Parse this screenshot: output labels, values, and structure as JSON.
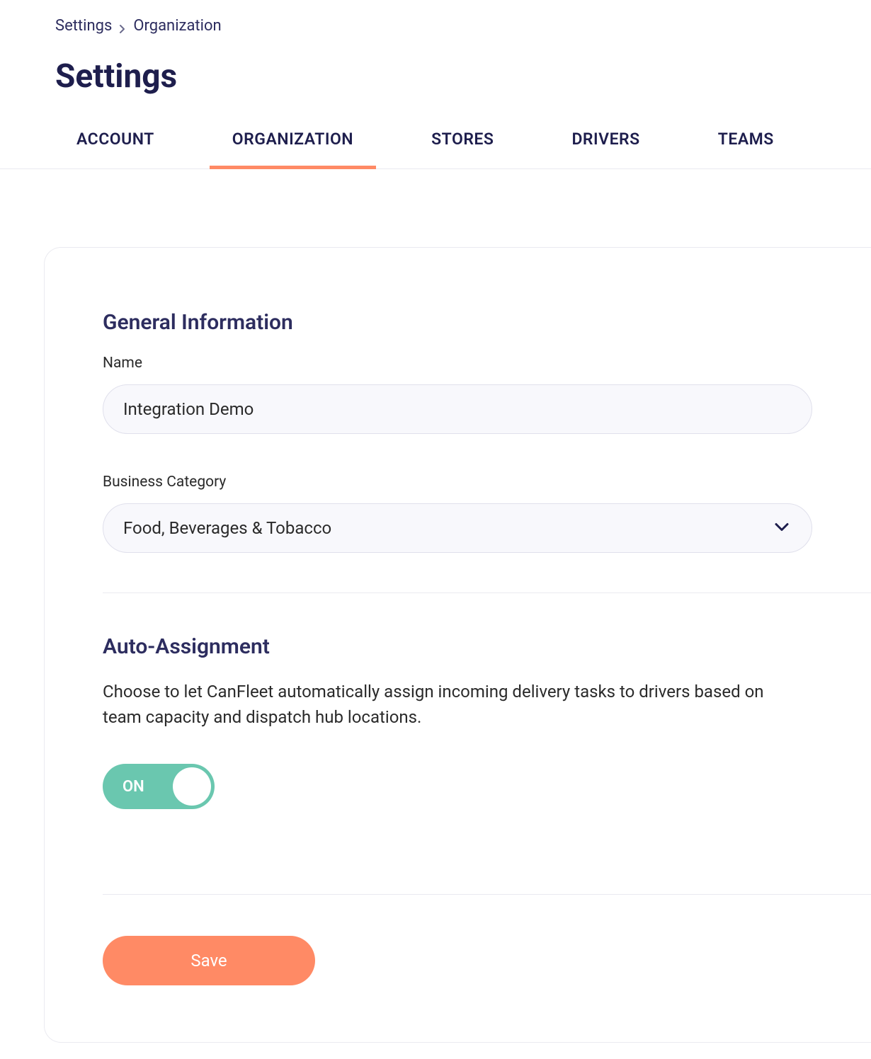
{
  "breadcrumb": {
    "root": "Settings",
    "current": "Organization"
  },
  "page_title": "Settings",
  "tabs": [
    {
      "label": "ACCOUNT",
      "active": false
    },
    {
      "label": "ORGANIZATION",
      "active": true
    },
    {
      "label": "STORES",
      "active": false
    },
    {
      "label": "DRIVERS",
      "active": false
    },
    {
      "label": "TEAMS",
      "active": false
    }
  ],
  "sections": {
    "general": {
      "title": "General Information",
      "name_label": "Name",
      "name_value": "Integration Demo",
      "category_label": "Business Category",
      "category_value": "Food, Beverages & Tobacco"
    },
    "auto_assignment": {
      "title": "Auto-Assignment",
      "description": "Choose to let CanFleet automatically assign incoming delivery tasks to drivers based on team capacity and dispatch hub locations.",
      "toggle_label": "ON",
      "toggle_on": true
    }
  },
  "buttons": {
    "save": "Save"
  }
}
